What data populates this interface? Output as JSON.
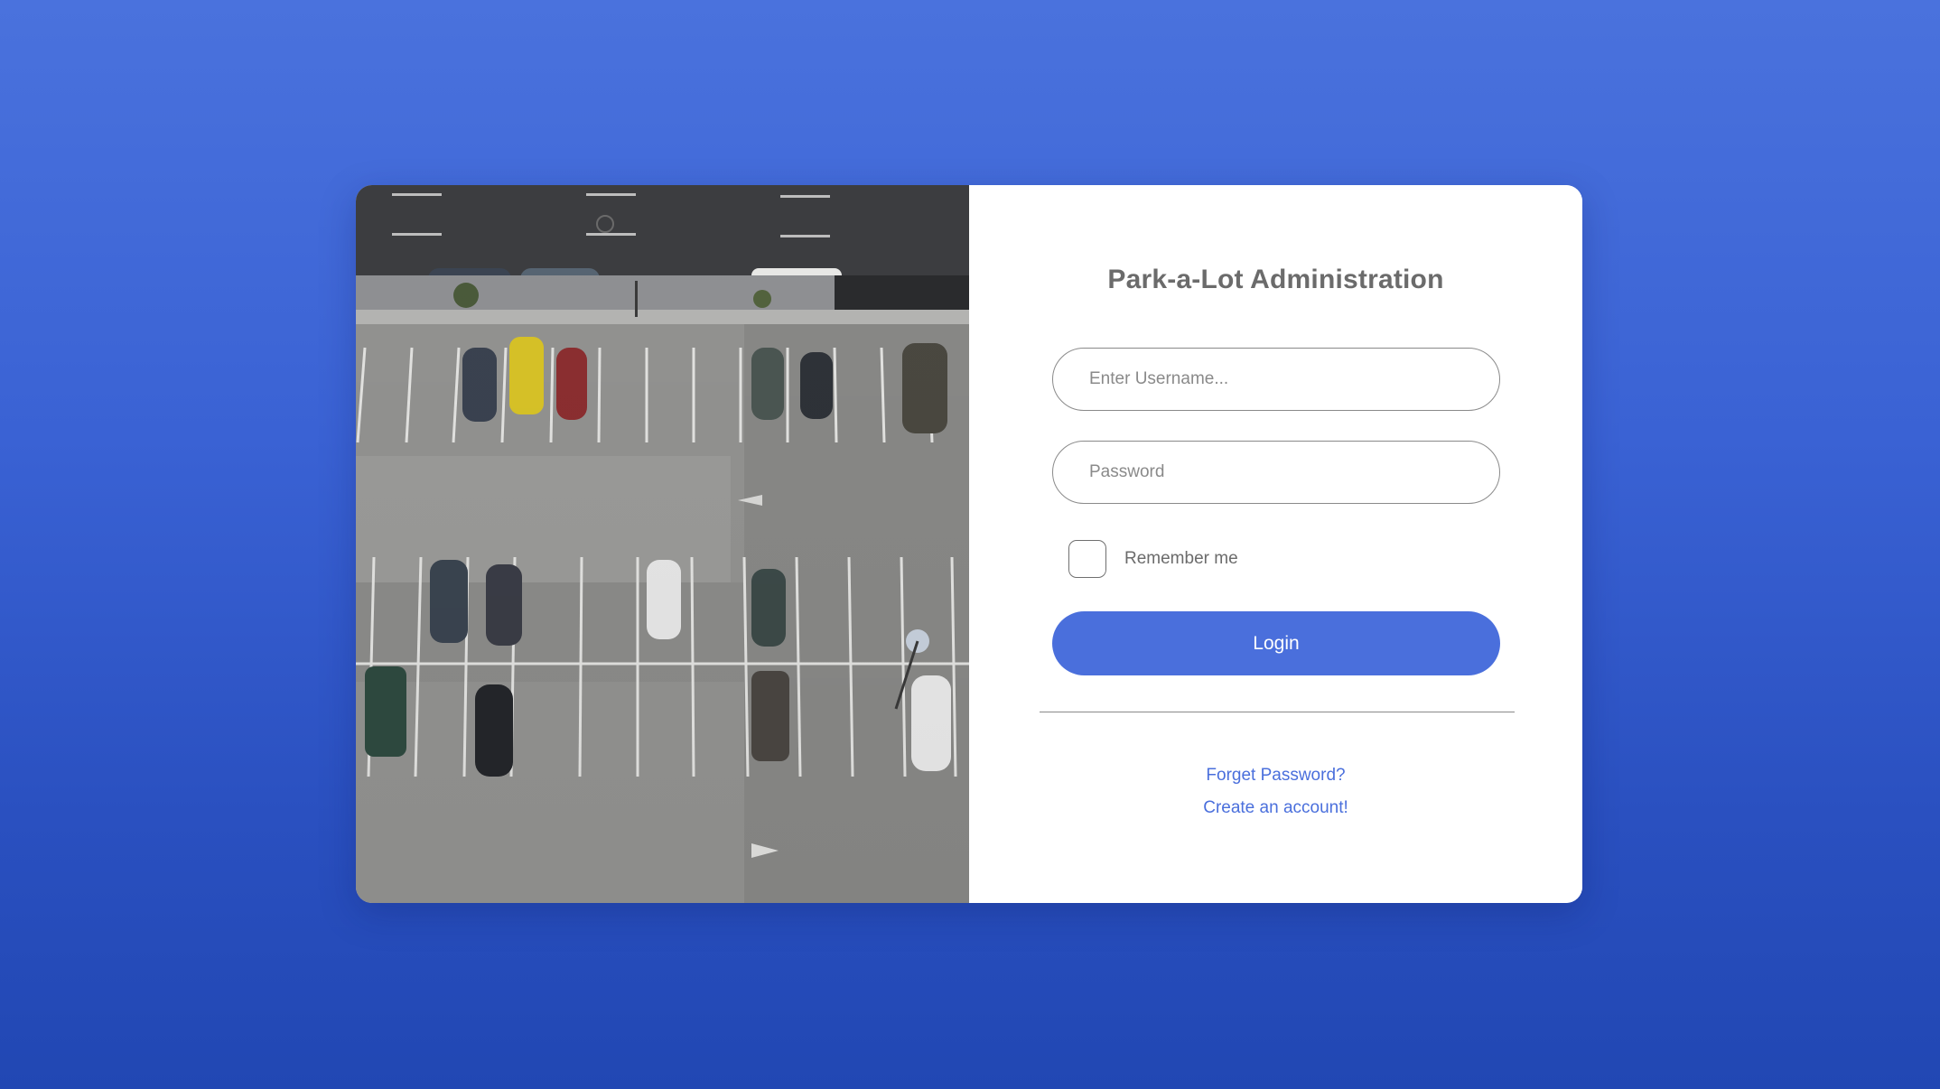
{
  "app": {
    "title": "Park-a-Lot Administration"
  },
  "login_form": {
    "username_placeholder": "Enter Username...",
    "password_placeholder": "Password",
    "remember_label": "Remember me",
    "remember_checked": false,
    "login_label": "Login",
    "forgot_label": "Forget Password?",
    "create_label": "Create an account!"
  },
  "colors": {
    "accent": "#4a6fdc",
    "background_top": "#4a72dd",
    "background_bottom": "#2147b3",
    "card": "#ffffff",
    "title_text": "#6b6b6b"
  },
  "icons": {
    "hero": "parking-lot-aerial-photo"
  }
}
